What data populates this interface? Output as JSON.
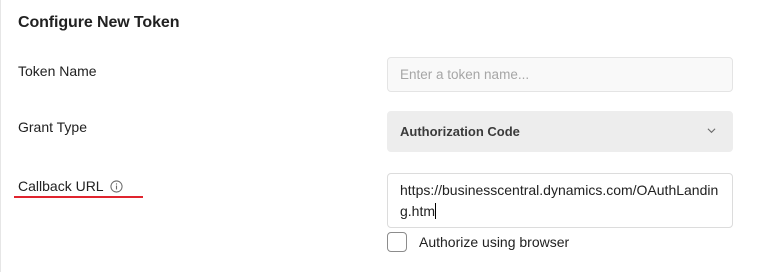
{
  "section": {
    "title": "Configure New Token"
  },
  "token_name": {
    "label": "Token Name",
    "placeholder": "Enter a token name...",
    "value": ""
  },
  "grant_type": {
    "label": "Grant Type",
    "selected": "Authorization Code",
    "icon": "chevron-down-icon"
  },
  "callback_url": {
    "label": "Callback URL",
    "info_icon": "info-icon",
    "value": "https://businesscentral.dynamics.com/OAuthLanding.htm"
  },
  "authorize_browser": {
    "label": "Authorize using browser",
    "checked": false
  },
  "colors": {
    "annotation_underline": "#e0242e",
    "select_background": "#ededed"
  }
}
